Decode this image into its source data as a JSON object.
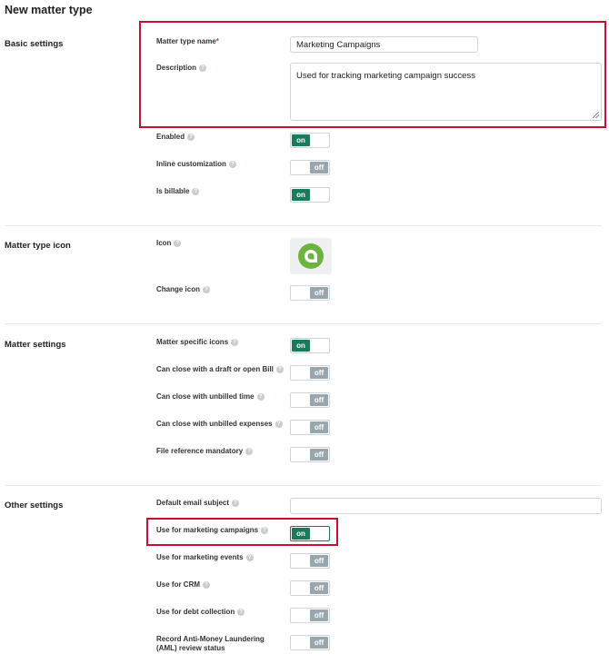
{
  "page_title": "New matter type",
  "sections": {
    "basic": "Basic settings",
    "icon": "Matter type icon",
    "matter": "Matter settings",
    "other": "Other settings"
  },
  "basic": {
    "matter_type_name_label": "Matter type name",
    "required_mark": "*",
    "matter_type_name_value": "Marketing Campaigns",
    "description_label": "Description",
    "description_value": "Used for tracking marketing campaign success",
    "enabled_label": "Enabled",
    "enabled_state": "on",
    "inline_customization_label": "Inline customization",
    "inline_customization_state": "off",
    "is_billable_label": "Is billable",
    "is_billable_state": "on"
  },
  "icon_section": {
    "icon_label": "Icon",
    "change_icon_label": "Change icon",
    "change_icon_state": "off",
    "icon_name": "speech-bubble-icon",
    "icon_color": "#6cb33f"
  },
  "matter_settings": {
    "specific_icons_label": "Matter specific icons",
    "specific_icons_state": "on",
    "close_draft_bill_label": "Can close with a draft or open Bill",
    "close_draft_bill_state": "off",
    "close_unbilled_time_label": "Can close with unbilled time",
    "close_unbilled_time_state": "off",
    "close_unbilled_expenses_label": "Can close with unbilled expenses",
    "close_unbilled_expenses_state": "off",
    "file_reference_label": "File reference mandatory",
    "file_reference_state": "off"
  },
  "other_settings": {
    "default_email_subject_label": "Default email subject",
    "default_email_subject_value": "",
    "marketing_campaigns_label": "Use for marketing campaigns",
    "marketing_campaigns_state": "on",
    "marketing_events_label": "Use for marketing events",
    "marketing_events_state": "off",
    "crm_label": "Use for CRM",
    "crm_state": "off",
    "debt_collection_label": "Use for debt collection",
    "debt_collection_state": "off",
    "aml_label_line1": "Record Anti-Money Laundering",
    "aml_label_line2": "(AML) review status",
    "aml_state": "off"
  },
  "colors": {
    "toggle_on": "#1a7a5c",
    "toggle_off": "#9aa6ad",
    "highlight": "#c8102e"
  }
}
